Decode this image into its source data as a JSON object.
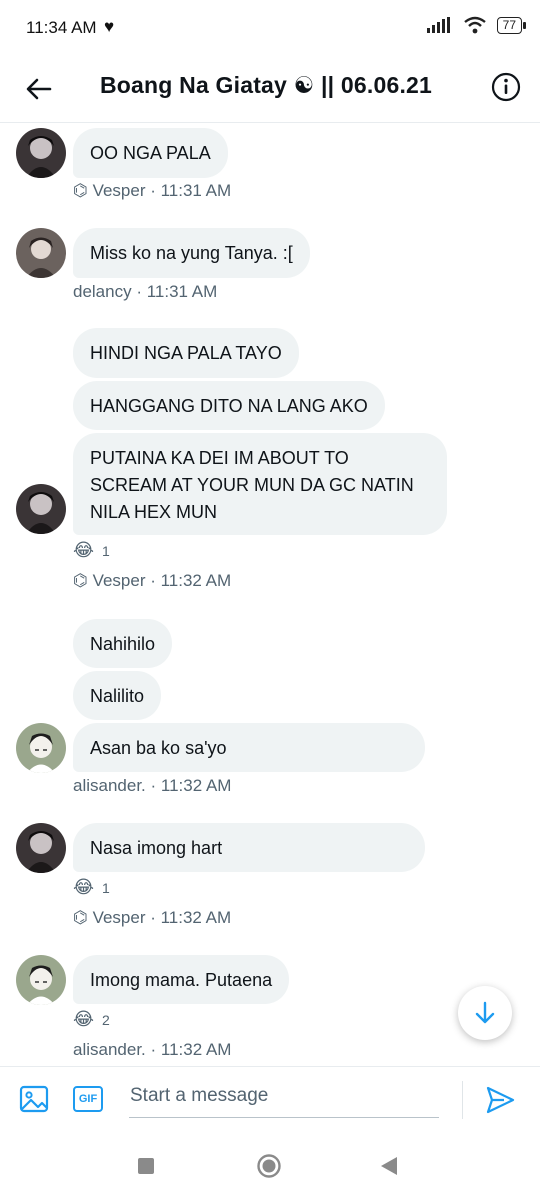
{
  "status": {
    "time": "11:34 AM",
    "battery": "77"
  },
  "header": {
    "title": "Boang Na Giatay ☯ || 06.06.21"
  },
  "messages": {
    "m1": "OO NGA PALA",
    "meta1": "⌬ Vesper · 11:31 AM",
    "m2": "Miss ko na yung Tanya. :[",
    "meta2": "delancy · 11:31 AM",
    "m3": "HINDI NGA PALA TAYO",
    "m4": "HANGGANG DITO NA LANG AKO",
    "m5": "PUTAINA KA DEI IM ABOUT TO SCREAM AT YOUR MUN DA GC NATIN NILA HEX MUN",
    "react5": "1",
    "meta5": "⌬ Vesper · 11:32 AM",
    "m6": "Nahihilo",
    "m7": "Nalilito",
    "m8": "Asan ba ko sa'yo",
    "meta8": "alisander. · 11:32 AM",
    "m9": "Nasa imong hart",
    "react9": "1",
    "meta9": "⌬ Vesper · 11:32 AM",
    "m10": "Imong mama. Putaena",
    "react10": "2",
    "meta10": "alisander. · 11:32 AM",
    "emoji": "😂"
  },
  "composer": {
    "placeholder": "Start a message",
    "gif_label": "GIF"
  },
  "colors": {
    "accent": "#1d9bf0",
    "bubble": "#eff3f4",
    "meta": "#536471"
  }
}
